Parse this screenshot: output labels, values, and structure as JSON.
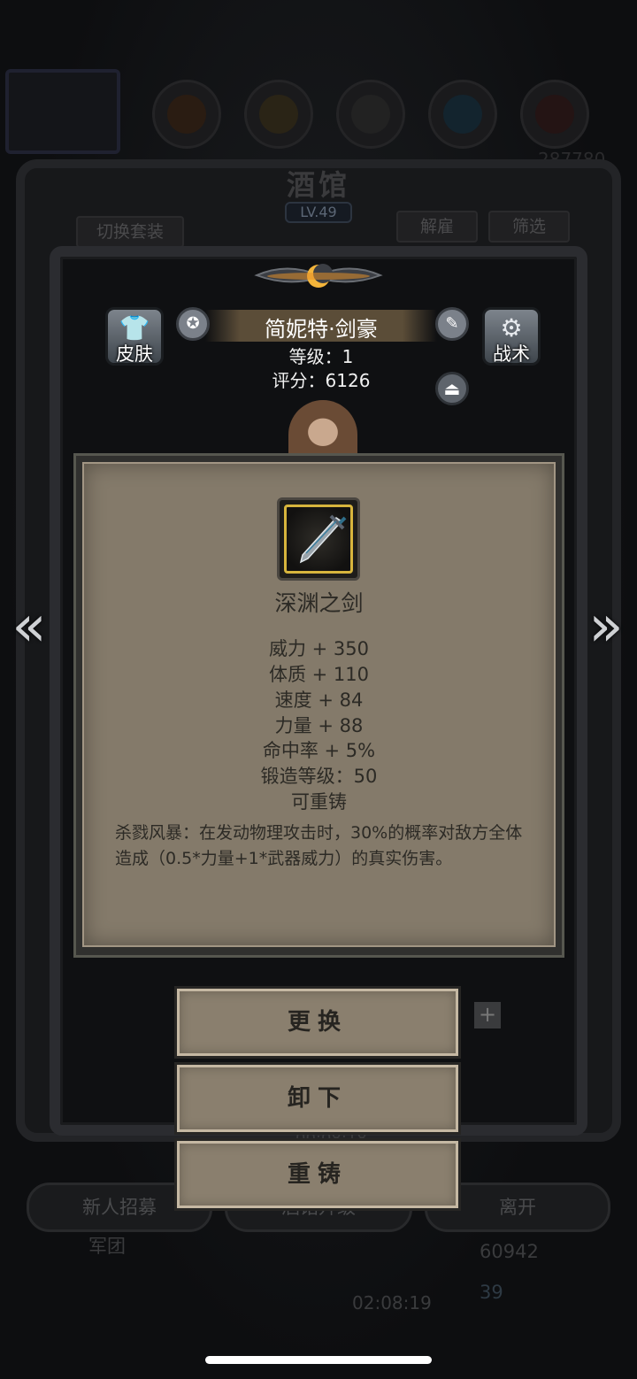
{
  "background": {
    "title": "酒馆",
    "level": "LV.49",
    "switch_outfit_label": "切换套装",
    "dismiss_label": "解雇",
    "filter_label": "筛选",
    "partial_number_top": "287780",
    "timer_mid": "00:08:18",
    "recruit_label": "新人招募",
    "upgrade_label": "酒馆升级",
    "leave_label": "离开",
    "guild_label": "军团",
    "gold_amount": "60942",
    "gem_amount": "39",
    "timer_bottom": "02:08:19"
  },
  "character": {
    "skin_label": "皮肤",
    "tactics_label": "战术",
    "name": "简妮特·剑豪",
    "level_line": "等级：1",
    "score_line": "评分：6126"
  },
  "item": {
    "name": "深渊之剑",
    "stats": [
      "威力 + 350",
      "体质 + 110",
      "速度 + 84",
      "力量 + 88",
      "命中率 + 5%",
      "锻造等级：50",
      "可重铸"
    ],
    "description": "杀戮风暴：在发动物理攻击时，30%的概率对敌方全体造成（0.5*力量+1*武器威力）的真实伤害。"
  },
  "actions": {
    "replace_label": "更换",
    "unequip_label": "卸下",
    "reforge_label": "重铸"
  },
  "icons": {
    "left_arrow": "double-chevron-left-icon",
    "right_arrow": "double-chevron-right-icon",
    "skin": "shirt-icon",
    "tactics": "gear-icon",
    "weapon": "sword-icon"
  },
  "colors": {
    "card_bg": "#847a6a",
    "button_bg": "#8a7f6e",
    "icon_border": "#d7b53d",
    "name_bar": "#5b4d38"
  }
}
